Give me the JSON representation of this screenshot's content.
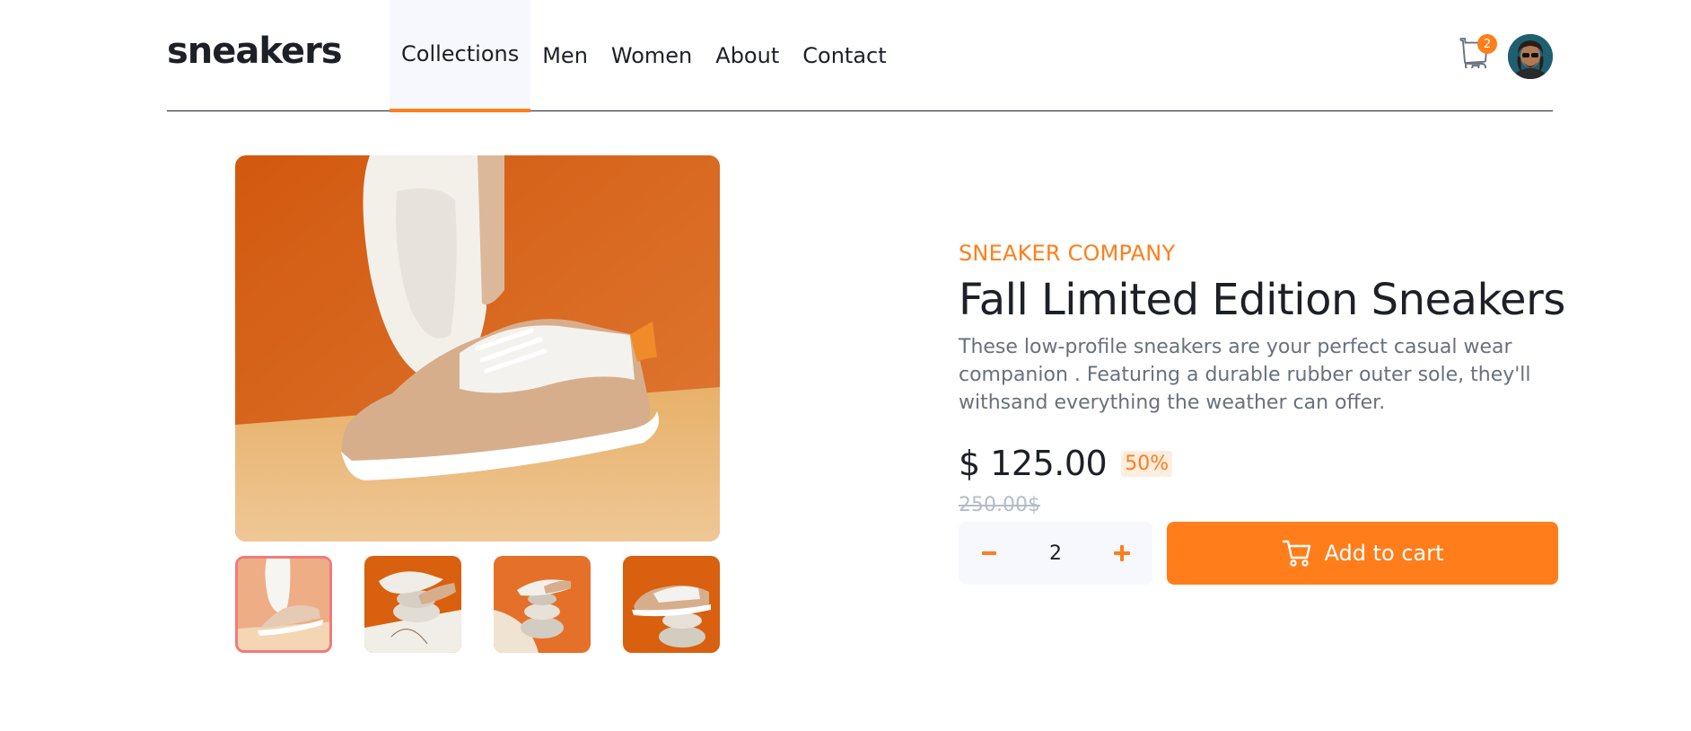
{
  "header": {
    "logo": "sneakers",
    "nav": [
      {
        "label": "Collections",
        "active": true
      },
      {
        "label": "Men"
      },
      {
        "label": "Women"
      },
      {
        "label": "About"
      },
      {
        "label": "Contact"
      }
    ],
    "cart_count": "2",
    "cart_icon": "cart-icon",
    "avatar_icon": "avatar"
  },
  "gallery": {
    "selected_thumbnail": 1,
    "thumbnail_count": 4
  },
  "product": {
    "company": "SNEAKER COMPANY",
    "title": "Fall Limited Edition Sneakers",
    "description": "These low-profile sneakers are your perfect casual wear companion . Featuring a durable rubber outer sole, they'll withsand everything the weather can offer.",
    "price": "$ 125.00",
    "discount": "50%",
    "original_price": "250.00$"
  },
  "cart_controls": {
    "quantity": "2",
    "minus_icon": "minus-icon",
    "plus_icon": "plus-icon",
    "add_to_cart_label": "Add to cart"
  },
  "colors": {
    "accent": "#ff7e1b",
    "accent_light": "#ffede0",
    "text_dark": "#1d2026",
    "text_muted": "#68707d",
    "text_faint": "#b6bcc8",
    "surface": "#f6f8fd"
  }
}
